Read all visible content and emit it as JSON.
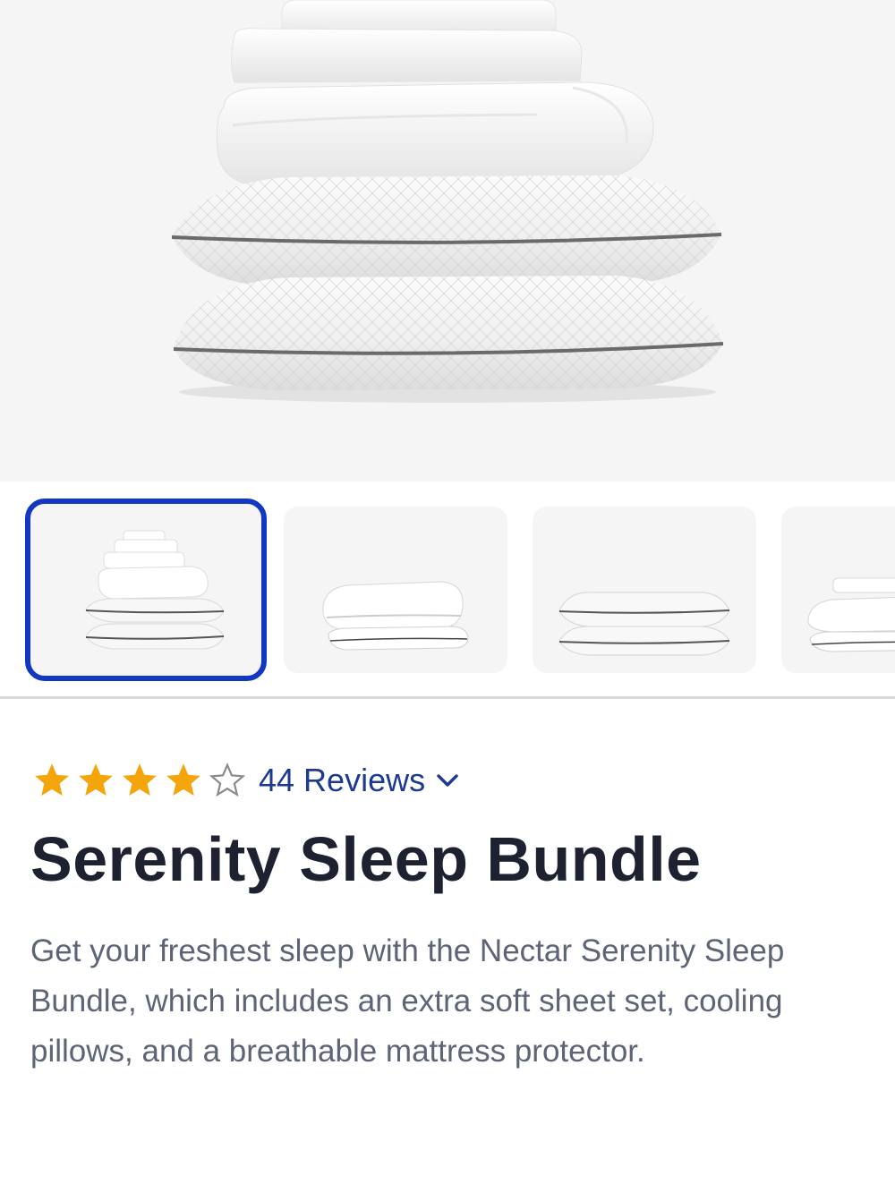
{
  "gallery": {
    "hero_image": "stacked-bedding-bundle",
    "thumbnails": [
      {
        "image": "full-bundle-stack",
        "selected": true
      },
      {
        "image": "folded-mattress-protector",
        "selected": false
      },
      {
        "image": "two-cooling-pillows",
        "selected": false
      },
      {
        "image": "folded-sheet-set",
        "selected": false
      }
    ]
  },
  "product": {
    "rating": 4,
    "rating_max": 5,
    "reviews_label": "44 Reviews",
    "title": "Serenity Sleep Bundle",
    "description": "Get your freshest sleep with the Nectar Serenity Sleep Bundle, which includes an extra soft sheet set, cooling pillows, and a breathable mattress protector."
  },
  "colors": {
    "star_filled": "#f5a50c",
    "star_empty_outline": "#8a8a8a",
    "selected_border": "#1237c3",
    "link": "#1c3a94",
    "title": "#1e2230",
    "body_text": "#5d6476"
  },
  "icons": {
    "star_filled": "star-filled-icon",
    "star_empty": "star-outline-icon",
    "reviews_toggle": "chevron-down-icon"
  }
}
